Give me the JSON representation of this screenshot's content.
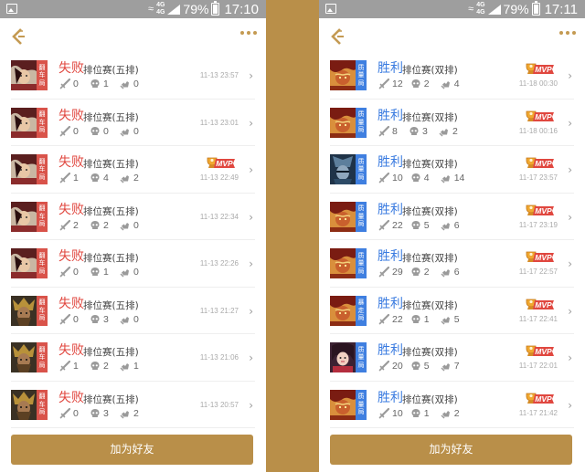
{
  "colors": {
    "accent": "#b98f49",
    "lose": "#e0473f",
    "win": "#3a7be0",
    "tag_red": "#d9534a",
    "tag_blue": "#3f7fe0",
    "statusbar": "#9e9e9e"
  },
  "screens": [
    {
      "status": {
        "battery": "79%",
        "time": "17:10",
        "network": "4G"
      },
      "button_label": "加为好友",
      "matches": [
        {
          "result": "失败",
          "type": "lose",
          "mode": "排位赛(五排)",
          "tag": "翻车局",
          "tag_color": "red",
          "kills": "0",
          "deaths": "1",
          "assists": "0",
          "time": "11-13 23:57",
          "mvp": false,
          "hero": "a"
        },
        {
          "result": "失败",
          "type": "lose",
          "mode": "排位赛(五排)",
          "tag": "翻车局",
          "tag_color": "red",
          "kills": "0",
          "deaths": "0",
          "assists": "0",
          "time": "11-13 23:01",
          "mvp": false,
          "hero": "a"
        },
        {
          "result": "失败",
          "type": "lose",
          "mode": "排位赛(五排)",
          "tag": "翻车局",
          "tag_color": "red",
          "kills": "1",
          "deaths": "4",
          "assists": "2",
          "time": "11-13 22:49",
          "mvp": true,
          "hero": "a"
        },
        {
          "result": "失败",
          "type": "lose",
          "mode": "排位赛(五排)",
          "tag": "翻车局",
          "tag_color": "red",
          "kills": "2",
          "deaths": "2",
          "assists": "0",
          "time": "11-13 22:34",
          "mvp": false,
          "hero": "a"
        },
        {
          "result": "失败",
          "type": "lose",
          "mode": "排位赛(五排)",
          "tag": "翻车局",
          "tag_color": "red",
          "kills": "0",
          "deaths": "1",
          "assists": "0",
          "time": "11-13 22:26",
          "mvp": false,
          "hero": "a"
        },
        {
          "result": "失败",
          "type": "lose",
          "mode": "排位赛(五排)",
          "tag": "翻车局",
          "tag_color": "red",
          "kills": "0",
          "deaths": "3",
          "assists": "0",
          "time": "11-13 21:27",
          "mvp": false,
          "hero": "b"
        },
        {
          "result": "失败",
          "type": "lose",
          "mode": "排位赛(五排)",
          "tag": "翻车局",
          "tag_color": "red",
          "kills": "1",
          "deaths": "2",
          "assists": "1",
          "time": "11-13 21:06",
          "mvp": false,
          "hero": "b"
        },
        {
          "result": "失败",
          "type": "lose",
          "mode": "排位赛(五排)",
          "tag": "翻车局",
          "tag_color": "red",
          "kills": "0",
          "deaths": "3",
          "assists": "2",
          "time": "11-13 20:57",
          "mvp": false,
          "hero": "b"
        }
      ]
    },
    {
      "status": {
        "battery": "79%",
        "time": "17:11",
        "network": "4G"
      },
      "button_label": "加为好友",
      "matches": [
        {
          "result": "胜利",
          "type": "win",
          "mode": "排位赛(双排)",
          "tag": "质量局",
          "tag_color": "blue",
          "kills": "12",
          "deaths": "2",
          "assists": "4",
          "time": "11-18 00:30",
          "mvp": true,
          "hero": "c"
        },
        {
          "result": "胜利",
          "type": "win",
          "mode": "排位赛(双排)",
          "tag": "质量局",
          "tag_color": "blue",
          "kills": "8",
          "deaths": "3",
          "assists": "2",
          "time": "11-18 00:16",
          "mvp": true,
          "hero": "c"
        },
        {
          "result": "胜利",
          "type": "win",
          "mode": "排位赛(双排)",
          "tag": "质量局",
          "tag_color": "blue",
          "kills": "10",
          "deaths": "4",
          "assists": "14",
          "time": "11-17 23:57",
          "mvp": true,
          "hero": "d"
        },
        {
          "result": "胜利",
          "type": "win",
          "mode": "排位赛(双排)",
          "tag": "质量局",
          "tag_color": "blue",
          "kills": "22",
          "deaths": "5",
          "assists": "6",
          "time": "11-17 23:19",
          "mvp": true,
          "hero": "c"
        },
        {
          "result": "胜利",
          "type": "win",
          "mode": "排位赛(双排)",
          "tag": "质量局",
          "tag_color": "blue",
          "kills": "29",
          "deaths": "2",
          "assists": "6",
          "time": "11-17 22:57",
          "mvp": true,
          "hero": "c"
        },
        {
          "result": "胜利",
          "type": "win",
          "mode": "排位赛(双排)",
          "tag": "暴走局",
          "tag_color": "blue",
          "kills": "22",
          "deaths": "1",
          "assists": "5",
          "time": "11-17 22:41",
          "mvp": true,
          "hero": "c"
        },
        {
          "result": "胜利",
          "type": "win",
          "mode": "排位赛(双排)",
          "tag": "质量局",
          "tag_color": "blue",
          "kills": "20",
          "deaths": "5",
          "assists": "7",
          "time": "11-17 22:01",
          "mvp": true,
          "hero": "e"
        },
        {
          "result": "胜利",
          "type": "win",
          "mode": "排位赛(双排)",
          "tag": "质量局",
          "tag_color": "blue",
          "kills": "10",
          "deaths": "1",
          "assists": "2",
          "time": "11-17 21:42",
          "mvp": true,
          "hero": "c"
        }
      ]
    }
  ]
}
